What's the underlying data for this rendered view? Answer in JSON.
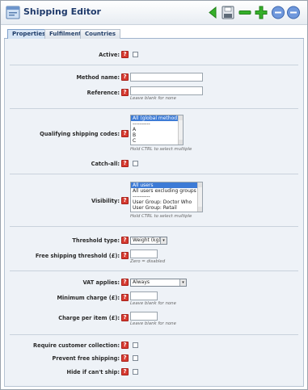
{
  "window": {
    "title": "Shipping Editor",
    "title_icon": "window-icon"
  },
  "toolbar": {
    "buttons": [
      "back-icon",
      "save-icon",
      "remove-icon",
      "add-icon",
      "previous-icon",
      "next-icon"
    ]
  },
  "tabs": [
    {
      "label": "Properties",
      "active": true
    },
    {
      "label": "Fulfilment",
      "active": false
    },
    {
      "label": "Countries",
      "active": false
    }
  ],
  "help_glyph": "?",
  "fields": {
    "active": {
      "label": "Active:",
      "checked": false
    },
    "method_name": {
      "label": "Method name:",
      "value": ""
    },
    "reference": {
      "label": "Reference:",
      "value": "",
      "hint": "Leave blank for none"
    },
    "qualifying_codes": {
      "label": "Qualifying shipping codes:",
      "options": [
        "All (global method)",
        "----------",
        "A",
        "B",
        "C"
      ],
      "selected_index": 0,
      "hint": "Hold CTRL to select multiple"
    },
    "catch_all": {
      "label": "Catch-all:",
      "checked": false
    },
    "visibility": {
      "label": "Visibility:",
      "options": [
        "All users",
        "All users excluding groups",
        "----------",
        "User Group: Doctor Who",
        "User Group: Retail"
      ],
      "selected_index": 0,
      "hint": "Hold CTRL to select multiple"
    },
    "threshold_type": {
      "label": "Threshold type:",
      "value": "Weight (kg)"
    },
    "free_shipping_threshold": {
      "label": "Free shipping threshold (£):",
      "value": "",
      "hint": "Zero = disabled"
    },
    "vat_applies": {
      "label": "VAT applies:",
      "value": "Always"
    },
    "minimum_charge": {
      "label": "Minimum charge (£):",
      "value": "",
      "hint": "Leave blank for none"
    },
    "charge_per_item": {
      "label": "Charge per item (£):",
      "value": "",
      "hint": "Leave blank for none"
    },
    "require_collection": {
      "label": "Require customer collection:",
      "checked": false
    },
    "prevent_free_shipping": {
      "label": "Prevent free shipping:",
      "checked": false
    },
    "hide_if_cant_ship": {
      "label": "Hide if can't ship:",
      "checked": false
    }
  },
  "colors": {
    "accent": "#3d7bd6",
    "help": "#d63b31",
    "panel": "#eef2f7",
    "title": "#1f3a6b",
    "toolbar_green": "#35b02a",
    "toolbar_blue": "#4d7fd1"
  }
}
